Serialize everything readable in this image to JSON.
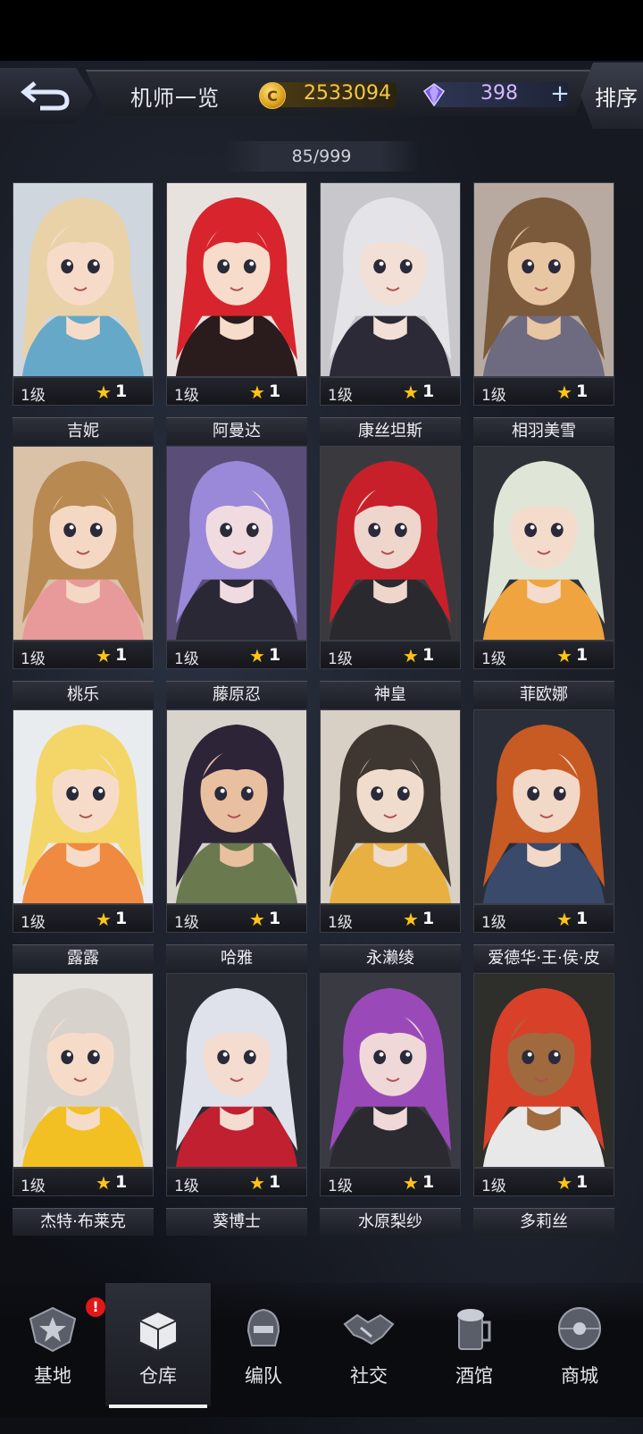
{
  "header": {
    "title": "机师一览",
    "gold_value": "2533094",
    "gem_value": "398",
    "plus_label": "+",
    "sort_label": "排序",
    "coin_glyph": "C"
  },
  "roster_count": "85/999",
  "characters": [
    {
      "name": "",
      "level": "1级",
      "stars": "1",
      "hair": "#e9d2a8",
      "skin": "#f6dcc8",
      "accent": "#66a8c8",
      "bg": "#cfd6de"
    },
    {
      "name": "",
      "level": "1级",
      "stars": "1",
      "hair": "#d8242c",
      "skin": "#f7dccb",
      "accent": "#2a1c1c",
      "bg": "#e8e2de"
    },
    {
      "name": "",
      "level": "1级",
      "stars": "1",
      "hair": "#e4e4e8",
      "skin": "#f2e0d6",
      "accent": "#2b2a36",
      "bg": "#c8c8cc"
    },
    {
      "name": "",
      "level": "1级",
      "stars": "1",
      "hair": "#7a5a3a",
      "skin": "#e8c6a2",
      "accent": "#6e6a80",
      "bg": "#b8aaa0"
    },
    {
      "name": "吉妮",
      "level": "1级",
      "stars": "1",
      "hair": "#b88a52",
      "skin": "#f4d8c4",
      "accent": "#e89a9a",
      "bg": "#d9c2a8"
    },
    {
      "name": "阿曼达",
      "level": "1级",
      "stars": "1",
      "hair": "#9a88d8",
      "skin": "#f0dbe0",
      "accent": "#2a2834",
      "bg": "#5a4e78"
    },
    {
      "name": "康丝坦斯",
      "level": "1级",
      "stars": "1",
      "hair": "#c8202a",
      "skin": "#efd6cc",
      "accent": "#2a2a2e",
      "bg": "#3a3a3e"
    },
    {
      "name": "相羽美雪",
      "level": "1级",
      "stars": "1",
      "hair": "#dfe6d8",
      "skin": "#f4dccc",
      "accent": "#f0a440",
      "bg": "#2e3238"
    },
    {
      "name": "桃乐",
      "level": "1级",
      "stars": "1",
      "hair": "#f4d668",
      "skin": "#f6dcc8",
      "accent": "#f08a40",
      "bg": "#e8ecef"
    },
    {
      "name": "藤原忍",
      "level": "1级",
      "stars": "1",
      "hair": "#2e2438",
      "skin": "#e8c0a0",
      "accent": "#6a7a4e",
      "bg": "#d8d4cc"
    },
    {
      "name": "神皇",
      "level": "1级",
      "stars": "1",
      "hair": "#3e3630",
      "skin": "#f0dccc",
      "accent": "#e8b040",
      "bg": "#d8d0c4"
    },
    {
      "name": "菲欧娜",
      "level": "1级",
      "stars": "1",
      "hair": "#c85a24",
      "skin": "#f2d8c6",
      "accent": "#3a4a6a",
      "bg": "#2a2e38"
    },
    {
      "name": "露露",
      "level": "1级",
      "stars": "1",
      "hair": "#d8d2cc",
      "skin": "#f6dcc8",
      "accent": "#f2c022",
      "bg": "#e4e0dc"
    },
    {
      "name": "哈雅",
      "level": "1级",
      "stars": "1",
      "hair": "#dfe2ea",
      "skin": "#f4dcd0",
      "accent": "#c02030",
      "bg": "#2a2c34"
    },
    {
      "name": "永濑绫",
      "level": "1级",
      "stars": "1",
      "hair": "#9a4ab8",
      "skin": "#f0d8d8",
      "accent": "#2a2a30",
      "bg": "#3a3a42"
    },
    {
      "name": "爱德华·王·侯·皮",
      "level": "1级",
      "stars": "1",
      "hair": "#d8402a",
      "skin": "#a06a3e",
      "accent": "#e8e8e8",
      "bg": "#2e2e2a"
    }
  ],
  "next_row_names": [
    "杰特·布莱克",
    "葵博士",
    "水原梨纱",
    "多莉丝"
  ],
  "nav": [
    {
      "label": "基地",
      "badge": "!"
    },
    {
      "label": "仓库"
    },
    {
      "label": "编队"
    },
    {
      "label": "社交"
    },
    {
      "label": "酒馆"
    },
    {
      "label": "商城"
    }
  ],
  "active_nav": "仓库",
  "colors": {
    "gold": "#f2c84b",
    "gem": "#d6b8ff",
    "star": "#ffc414",
    "alert": "#e01818"
  }
}
